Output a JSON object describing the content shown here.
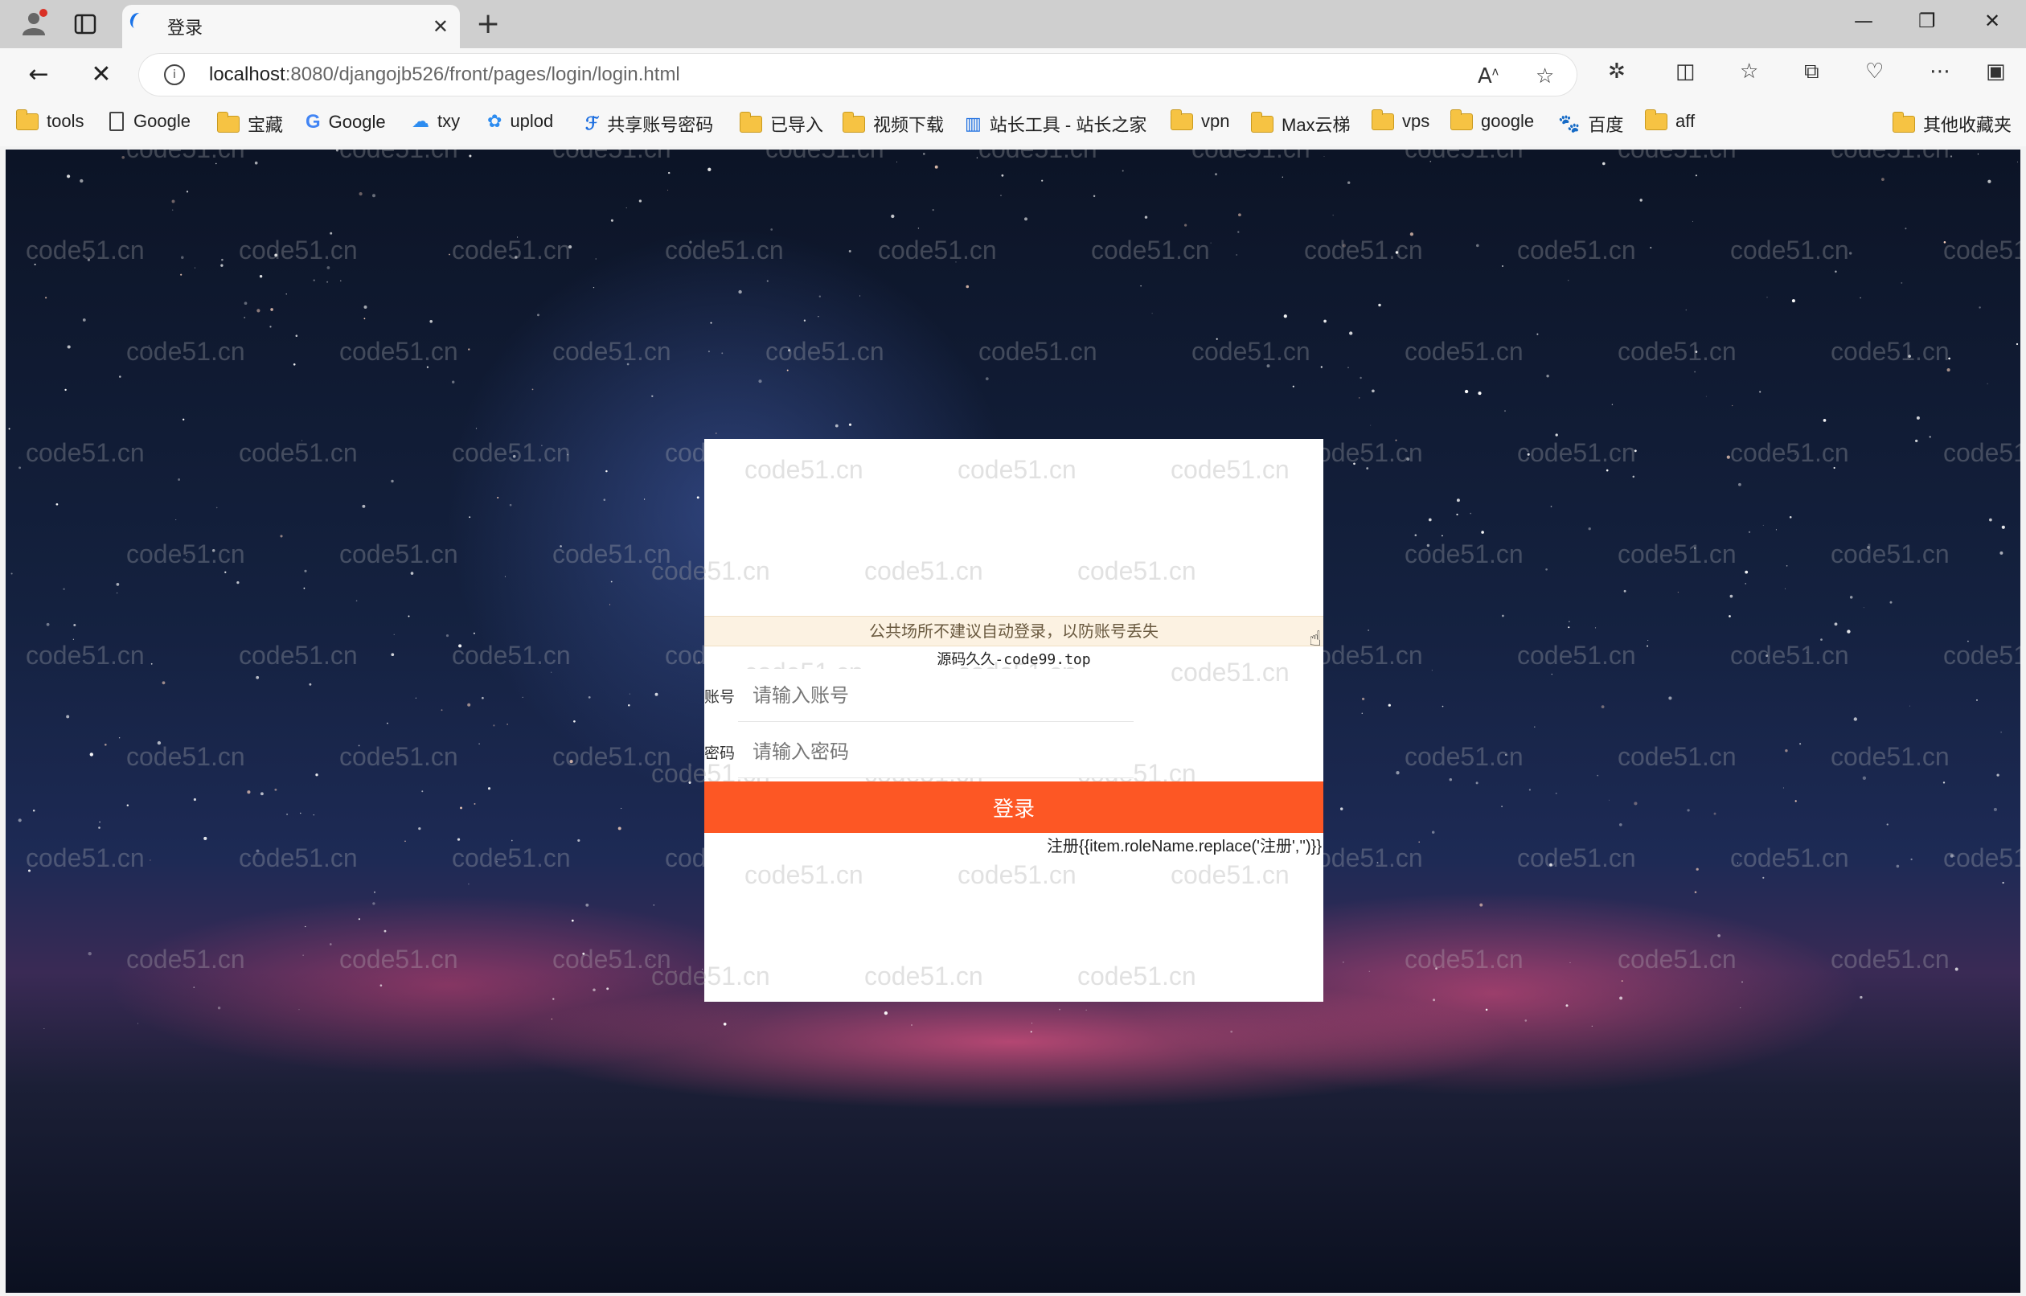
{
  "tab": {
    "title": "登录",
    "close": "✕",
    "new_tab": "+"
  },
  "window_controls": {
    "minimize": "—",
    "restore": "❐",
    "close": "✕"
  },
  "address_bar": {
    "url_host": "localhost",
    "url_path": ":8080/djangojb526/front/pages/login/login.html"
  },
  "bookmarks": [
    {
      "label": "tools",
      "icon": "folder-icon"
    },
    {
      "label": "Google",
      "icon": "page-icon"
    },
    {
      "label": "宝藏",
      "icon": "folder-icon"
    },
    {
      "label": "Google",
      "icon": "google-icon"
    },
    {
      "label": "txy",
      "icon": "cloud-icon"
    },
    {
      "label": "uplod",
      "icon": "upload-icon"
    },
    {
      "label": "共享账号密码",
      "icon": "share-icon"
    },
    {
      "label": "已导入",
      "icon": "folder-icon"
    },
    {
      "label": "视频下载",
      "icon": "folder-icon"
    },
    {
      "label": "站长工具 - 站长之家",
      "icon": "chart-icon"
    },
    {
      "label": "vpn",
      "icon": "folder-icon"
    },
    {
      "label": "Max云梯",
      "icon": "folder-icon"
    },
    {
      "label": "vps",
      "icon": "folder-icon"
    },
    {
      "label": "google",
      "icon": "folder-icon"
    },
    {
      "label": "百度",
      "icon": "baidu-icon"
    },
    {
      "label": "aff",
      "icon": "folder-icon"
    }
  ],
  "other_bookmarks": "其他收藏夹",
  "watermark": "code51.cn",
  "login": {
    "notice": "公共场所不建议自动登录，以防账号丢失",
    "source": "源码久久-code99.top",
    "account_label": "账号",
    "account_placeholder": "请输入账号",
    "password_label": "密码",
    "password_placeholder": "请输入密码",
    "login_button": "登录",
    "register_link": "注册{{item.roleName.replace('注册','')}}"
  },
  "colors": {
    "login_button": "#fd5724",
    "notice_bg": "#fcf2e2"
  }
}
